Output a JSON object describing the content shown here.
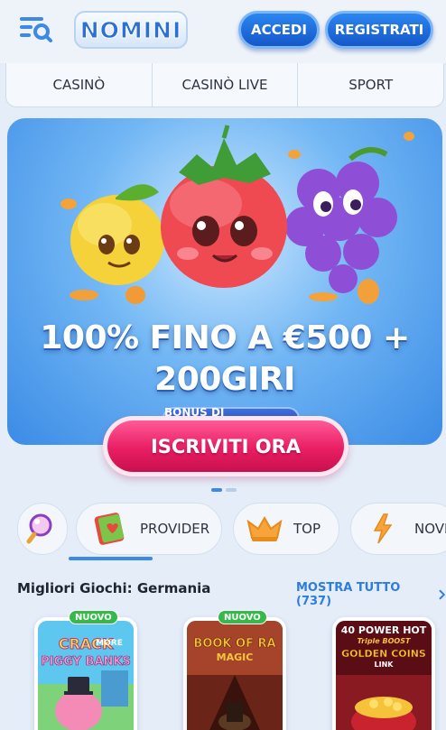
{
  "header": {
    "menu_icon": "menu-search-icon",
    "logo_text": "NOMINI",
    "login_label": "ACCEDI",
    "register_label": "REGISTRATI"
  },
  "nav": {
    "tabs": [
      {
        "label": "CASINÒ"
      },
      {
        "label": "CASINÒ LIVE"
      },
      {
        "label": "SPORT"
      }
    ]
  },
  "banner": {
    "badge": "BONUS DI BENVENUTO",
    "headline_line1": "100% FINO A €500 +",
    "headline_line2": "200GIRI",
    "cta_label": "ISCRIVITI ORA",
    "slide_count": 2,
    "active_slide": 1
  },
  "categories": {
    "search_icon": "magnifier-icon",
    "items": [
      {
        "label": "PROVIDER",
        "icon": "book-icon"
      },
      {
        "label": "TOP",
        "icon": "crown-icon"
      },
      {
        "label": "NOVI",
        "icon": "lightning-icon"
      }
    ]
  },
  "section": {
    "title": "Migliori Giochi: Germania",
    "show_all": "MOSTRA TUTTO (737)"
  },
  "games": [
    {
      "tag": "NUOVO",
      "title_line1": "CRACK",
      "title_line2": "MORE",
      "title_line3": "PIGGY BANKS"
    },
    {
      "tag": "NUOVO",
      "title_line1": "BOOK OF RA",
      "title_line2": "MAGIC"
    },
    {
      "title_line1": "40 POWER HOT",
      "title_line2": "Triple BOOST",
      "title_line3": "GOLDEN COINS",
      "title_line4": "LINK"
    }
  ],
  "colors": {
    "primary_blue": "#1f6fe0",
    "cta_pink": "#e91e63",
    "new_green": "#36b84a"
  }
}
